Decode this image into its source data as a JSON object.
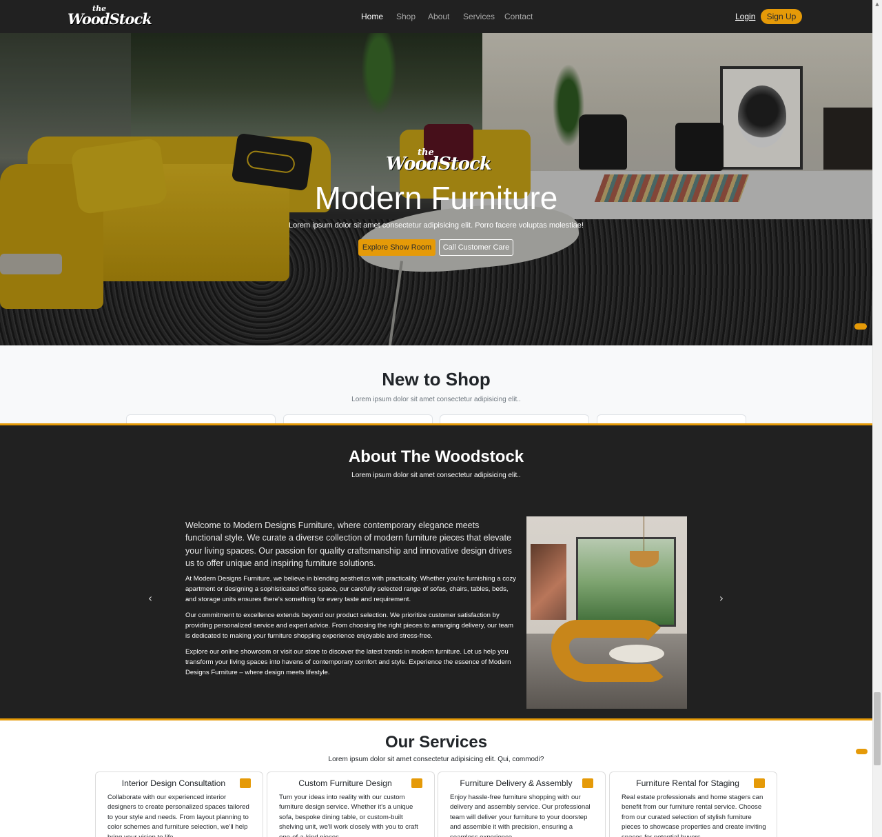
{
  "brand": {
    "the": "the",
    "name": "WoodStock"
  },
  "nav": {
    "links": [
      "Home",
      "Shop",
      "About",
      "Services",
      "Contact"
    ],
    "active": "Home",
    "login": "Login",
    "signup": "Sign Up"
  },
  "hero": {
    "logo_the": "the",
    "logo_name": "WoodStock",
    "title": "Modern Furniture",
    "subtitle": "Lorem ipsum dolor sit amet consectetur adipisicing elit. Porro facere voluptas molestiae!",
    "primary_button": "Explore Show Room",
    "secondary_button": "Call Customer Care"
  },
  "shop": {
    "title": "New to Shop",
    "subtitle": "Lorem ipsum dolor sit amet consectetur adipisicing elit.."
  },
  "about": {
    "title": "About The Woodstock",
    "subtitle": "Lorem ipsum dolor sit amet consectetur adipisicing elit..",
    "lead": "Welcome to Modern Designs Furniture, where contemporary elegance meets functional style. We curate a diverse collection of modern furniture pieces that elevate your living spaces. Our passion for quality craftsmanship and innovative design drives us to offer unique and inspiring furniture solutions.",
    "p1": "At Modern Designs Furniture, we believe in blending aesthetics with practicality. Whether you're furnishing a cozy apartment or designing a sophisticated office space, our carefully selected range of sofas, chairs, tables, beds, and storage units ensures there's something for every taste and requirement.",
    "p2": "Our commitment to excellence extends beyond our product selection. We prioritize customer satisfaction by providing personalized service and expert advice. From choosing the right pieces to arranging delivery, our team is dedicated to making your furniture shopping experience enjoyable and stress-free.",
    "p3": "Explore our online showroom or visit our store to discover the latest trends in modern furniture. Let us help you transform your living spaces into havens of contemporary comfort and style. Experience the essence of Modern Designs Furniture – where design meets lifestyle.",
    "prev_icon": "‹",
    "next_icon": "›"
  },
  "services": {
    "title": "Our Services",
    "subtitle": "Lorem ipsum dolor sit amet consectetur adipisicing elit. Qui, commodi?",
    "cards": [
      {
        "title": "Interior Design Consultation",
        "body": "Collaborate with our experienced interior designers to create personalized spaces tailored to your style and needs. From layout planning to color schemes and furniture selection, we'll help bring your vision to life."
      },
      {
        "title": "Custom Furniture Design",
        "body": "Turn your ideas into reality with our custom furniture design service. Whether it's a unique sofa, bespoke dining table, or custom-built shelving unit, we'll work closely with you to craft one-of-a-kind pieces."
      },
      {
        "title": "Furniture Delivery & Assembly",
        "body": "Enjoy hassle-free furniture shopping with our delivery and assembly service. Our professional team will deliver your furniture to your doorstep and assemble it with precision, ensuring a seamless experience."
      },
      {
        "title": "Furniture Rental for Staging",
        "body": "Real estate professionals and home stagers can benefit from our furniture rental service. Choose from our curated selection of stylish furniture pieces to showcase properties and create inviting spaces for potential buyers."
      }
    ]
  },
  "colors": {
    "accent": "#e59a08",
    "dark": "#212121",
    "light": "#f8f9fa"
  }
}
